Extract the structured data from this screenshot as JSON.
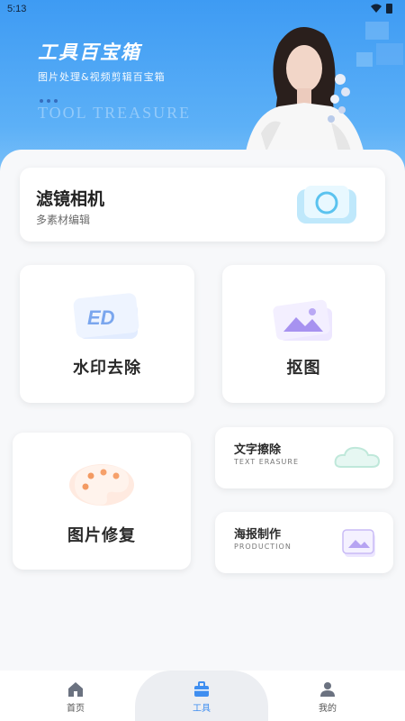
{
  "status_bar": {
    "time": "5:13"
  },
  "hero": {
    "title": "工具百宝箱",
    "subtitle": "图片处理&视频剪辑百宝箱",
    "watermark": "TOOL TREASURE"
  },
  "features": {
    "filter_camera": {
      "title": "滤镜相机",
      "subtitle": "多素材编辑"
    },
    "watermark_removal": {
      "title": "水印去除",
      "icon_text": "ED"
    },
    "cutout": {
      "title": "抠图"
    },
    "photo_repair": {
      "title": "图片修复"
    },
    "text_erasure": {
      "title": "文字擦除",
      "subtitle": "TEXT ERASURE"
    },
    "poster": {
      "title": "海报制作",
      "subtitle": "PRODUCTION"
    }
  },
  "bottom_nav": {
    "items": [
      {
        "label": "首页",
        "icon": "home-icon"
      },
      {
        "label": "工具",
        "icon": "toolbox-icon",
        "active": true
      },
      {
        "label": "我的",
        "icon": "profile-icon"
      }
    ]
  },
  "colors": {
    "accent": "#3f8ef0",
    "header": "#4aa2f5"
  }
}
